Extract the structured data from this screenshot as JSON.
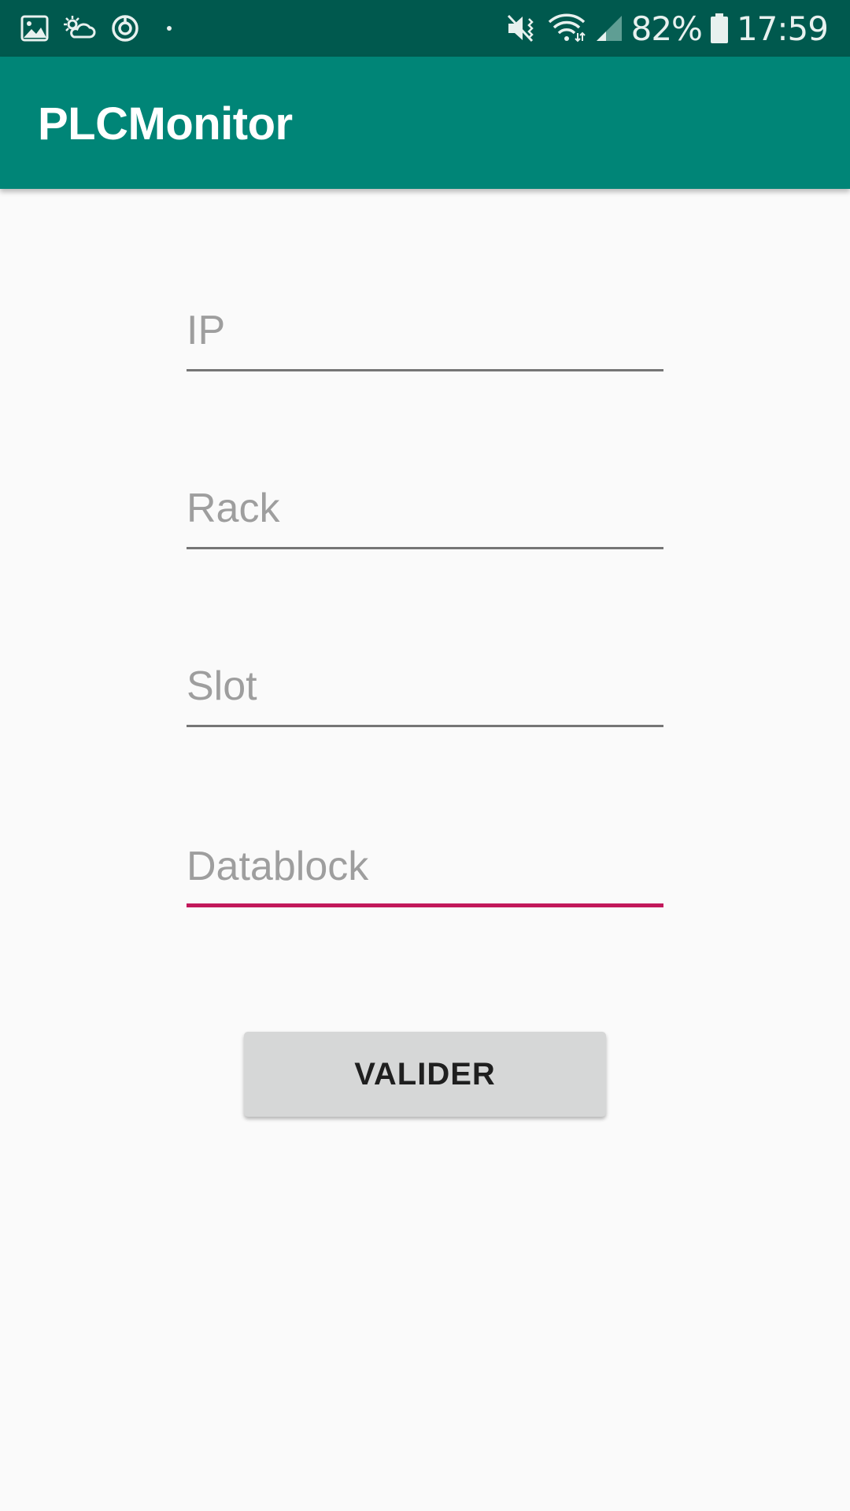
{
  "status_bar": {
    "left_icons": [
      "gallery-icon",
      "weather-icon",
      "sync-icon",
      "dot-icon"
    ],
    "right_icons": [
      "vibrate-icon",
      "wifi-icon",
      "signal-icon",
      "battery-icon"
    ],
    "battery": "82%",
    "time": "17:59",
    "background": "#00594e"
  },
  "app_bar": {
    "title": "PLCMonitor",
    "background": "#008577"
  },
  "form": {
    "fields": [
      {
        "placeholder": "IP",
        "value": ""
      },
      {
        "placeholder": "Rack",
        "value": ""
      },
      {
        "placeholder": "Slot",
        "value": ""
      },
      {
        "placeholder": "Datablock",
        "value": "",
        "focused": true
      }
    ],
    "accent": "#c2185b",
    "submit_label": "VALIDER"
  }
}
